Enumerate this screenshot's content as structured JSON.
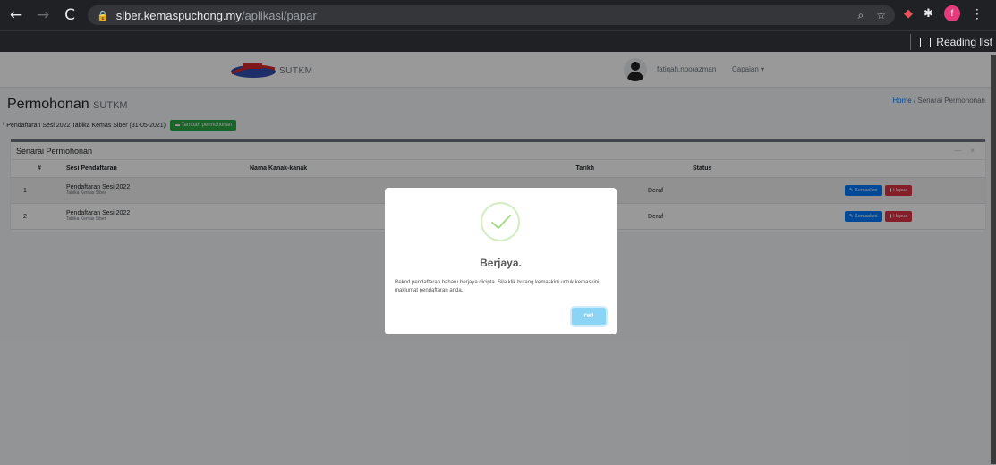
{
  "browser": {
    "url_host": "siber.kemaspuchong.my",
    "url_path": "/aplikasi/papar",
    "reading_list": "Reading list",
    "profile_initial": "f"
  },
  "header": {
    "brand": "SUTKM",
    "username": "fatiqah.noorazman",
    "capaian": "Capaian ▾"
  },
  "page": {
    "title": "Permohonan",
    "title_small": "SUTKM",
    "breadcrumb_home": "Home",
    "breadcrumb_current": "Senarai Permohonan",
    "registration_info": "Pendaftaran Sesi 2022 Tabika Kemas Siber (31-05-2021)",
    "add_button": "Tambah permohonan"
  },
  "card": {
    "title": "Senarai Permohonan",
    "tools": [
      "—",
      "×"
    ]
  },
  "table": {
    "headers": [
      "#",
      "Sesi Pendaftaran",
      "Nama Kanak-kanak",
      "Tarikh",
      "Status"
    ],
    "rows": [
      {
        "no": "1",
        "sesi": "Pendaftaran Sesi 2022",
        "sub": "Tabika Kemas Siber",
        "nama": "",
        "tarikh": "",
        "status": "Deraf"
      },
      {
        "no": "2",
        "sesi": "Pendaftaran Sesi 2022",
        "sub": "Tabika Kemas Siber",
        "nama": "",
        "tarikh": "",
        "status": "Deraf"
      }
    ],
    "edit_label": "Kemaskini",
    "delete_label": "Hapus"
  },
  "modal": {
    "title": "Berjaya.",
    "text": "Rekod pendaftaran baharu berjaya dicipta. Sila klik butang kemaskini untuk kemaskini maklumat pendaftaran anda.",
    "ok": "OK!"
  },
  "colors": {
    "chrome": "#202124",
    "success_button": "#28a745",
    "edit_button": "#007bff",
    "delete_button": "#dc3545",
    "ok_button": "#8cd4f5"
  }
}
